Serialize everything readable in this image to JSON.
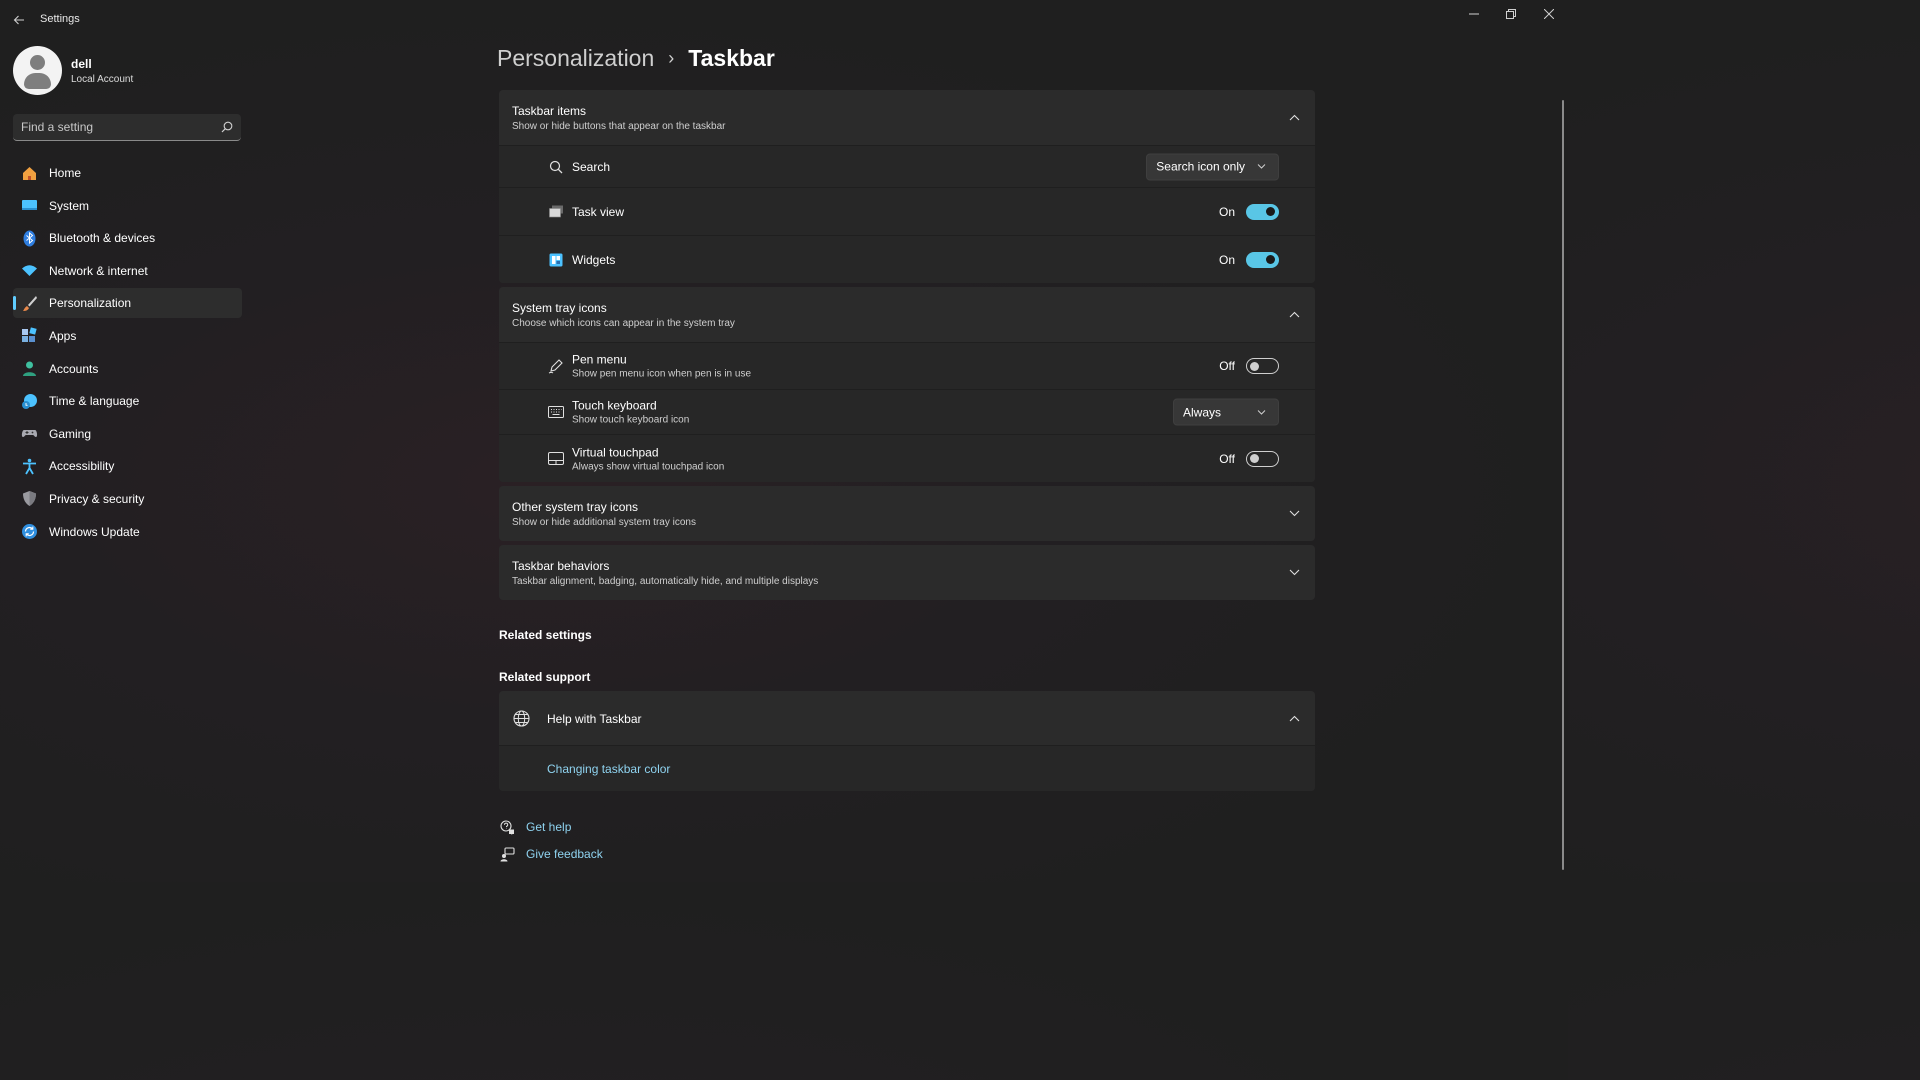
{
  "window": {
    "title": "Settings"
  },
  "profile": {
    "name": "dell",
    "account_type": "Local Account"
  },
  "search": {
    "placeholder": "Find a setting"
  },
  "sidebar": {
    "items": [
      {
        "label": "Home",
        "icon": "home-icon",
        "color": "#f0a040"
      },
      {
        "label": "System",
        "icon": "system-icon",
        "color": "#4cc2ff"
      },
      {
        "label": "Bluetooth & devices",
        "icon": "bluetooth-icon",
        "color": "#2f7ee0"
      },
      {
        "label": "Network & internet",
        "icon": "wifi-icon",
        "color": "#4cc2ff"
      },
      {
        "label": "Personalization",
        "icon": "brush-icon",
        "color": "#e8884a",
        "active": true
      },
      {
        "label": "Apps",
        "icon": "apps-icon",
        "color": "#7ab0e0"
      },
      {
        "label": "Accounts",
        "icon": "accounts-icon",
        "color": "#3fc0a0"
      },
      {
        "label": "Time & language",
        "icon": "time-language-icon",
        "color": "#4cc2ff"
      },
      {
        "label": "Gaming",
        "icon": "gaming-icon",
        "color": "#a8a8b0"
      },
      {
        "label": "Accessibility",
        "icon": "accessibility-icon",
        "color": "#4cc2ff"
      },
      {
        "label": "Privacy & security",
        "icon": "shield-icon",
        "color": "#9a9aa0"
      },
      {
        "label": "Windows Update",
        "icon": "update-icon",
        "color": "#2f8fe0"
      }
    ]
  },
  "breadcrumb": {
    "parent": "Personalization",
    "separator": "›",
    "current": "Taskbar"
  },
  "taskbar_items": {
    "title": "Taskbar items",
    "subtitle": "Show or hide buttons that appear on the taskbar",
    "rows": {
      "search": {
        "label": "Search",
        "value": "Search icon only"
      },
      "task_view": {
        "label": "Task view",
        "state": "On"
      },
      "widgets": {
        "label": "Widgets",
        "state": "On"
      }
    }
  },
  "system_tray": {
    "title": "System tray icons",
    "subtitle": "Choose which icons can appear in the system tray",
    "rows": {
      "pen_menu": {
        "label": "Pen menu",
        "sub": "Show pen menu icon when pen is in use",
        "state": "Off"
      },
      "touch_keyboard": {
        "label": "Touch keyboard",
        "sub": "Show touch keyboard icon",
        "value": "Always"
      },
      "virtual_touchpad": {
        "label": "Virtual touchpad",
        "sub": "Always show virtual touchpad icon",
        "state": "Off"
      }
    }
  },
  "other_tray": {
    "title": "Other system tray icons",
    "subtitle": "Show or hide additional system tray icons"
  },
  "behaviors": {
    "title": "Taskbar behaviors",
    "subtitle": "Taskbar alignment, badging, automatically hide, and multiple displays"
  },
  "related_settings": {
    "heading": "Related settings"
  },
  "related_support": {
    "heading": "Related support",
    "help_title": "Help with Taskbar",
    "link": "Changing taskbar color"
  },
  "footer": {
    "get_help": "Get help",
    "give_feedback": "Give feedback"
  },
  "colors": {
    "accent": "#4cc2ff",
    "link": "#8fd3f0",
    "background": "#202020",
    "card": "#2b2b2b"
  }
}
